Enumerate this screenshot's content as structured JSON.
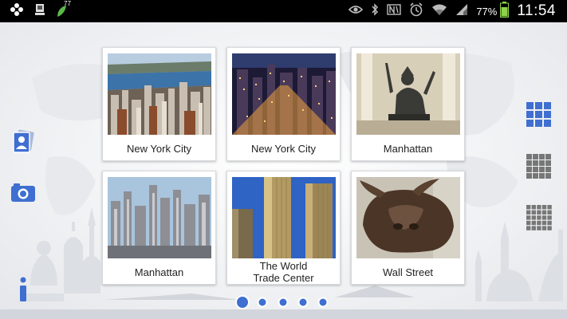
{
  "status_bar": {
    "notification_badge": "77",
    "battery_percent": "77%",
    "clock": "11:54"
  },
  "tiles": [
    {
      "caption": "New York City",
      "photo": "manhattan-skyline-river"
    },
    {
      "caption": "New York City",
      "photo": "manhattan-night-aerial"
    },
    {
      "caption": "Manhattan",
      "photo": "alma-mater-statue"
    },
    {
      "caption": "Manhattan",
      "photo": "midtown-skyscrapers"
    },
    {
      "caption": "The World\nTrade Center",
      "photo": "twin-towers"
    },
    {
      "caption": "Wall Street",
      "photo": "charging-bull"
    }
  ],
  "colors": {
    "accent_blue": "#3f6fd0",
    "grid_gray": "#777777",
    "status_bar": "#000000"
  },
  "pager": {
    "page_count": 5,
    "current_page": 1
  }
}
